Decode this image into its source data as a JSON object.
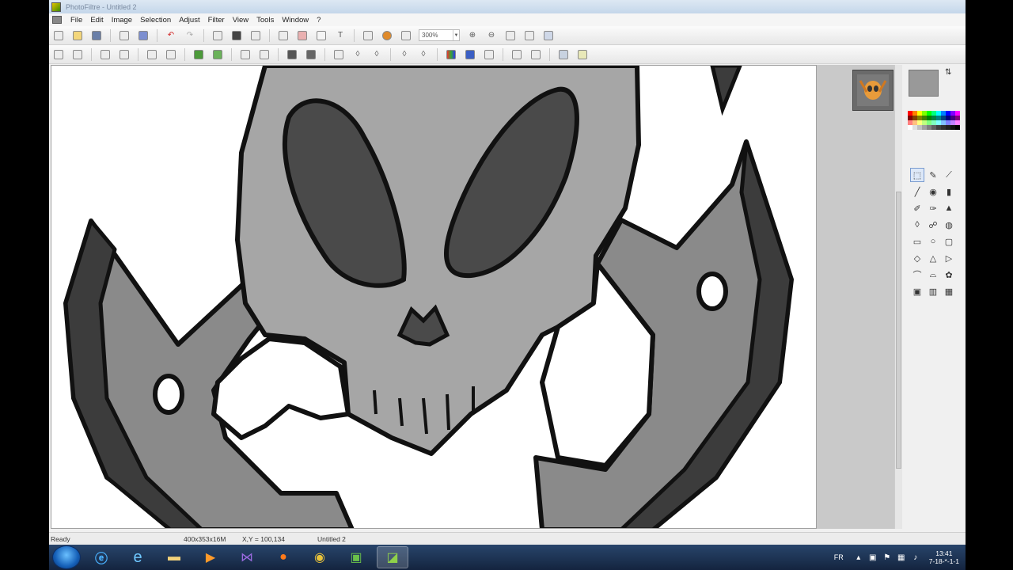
{
  "window": {
    "title": "PhotoFiltre - Untitled 2"
  },
  "menu": [
    "File",
    "Edit",
    "Image",
    "Selection",
    "Adjust",
    "Filter",
    "View",
    "Tools",
    "Window",
    "?"
  ],
  "toolbar": {
    "zoom_value": "300%"
  },
  "status": {
    "ready": "Ready",
    "size": "400x353x16M",
    "coords": "X,Y = 100,134",
    "doc": "Untitled 2"
  },
  "taskbar": {
    "apps": [
      "windows-explorer",
      "ie",
      "file-explorer",
      "media-player",
      "visual-studio",
      "firefox",
      "chrome",
      "app-green",
      "photofiltre"
    ],
    "lang": "FR",
    "time": "13:41",
    "date": "7-18-*-1-1"
  },
  "palette_colors": [
    "#ff0000",
    "#ff8000",
    "#ffff00",
    "#80ff00",
    "#00ff00",
    "#00ff80",
    "#00ffff",
    "#0080ff",
    "#0000ff",
    "#8000ff",
    "#ff00ff",
    "#800000",
    "#804000",
    "#808000",
    "#408000",
    "#008000",
    "#008040",
    "#008080",
    "#004080",
    "#000080",
    "#400080",
    "#800080",
    "#ff8080",
    "#ffc080",
    "#ffff80",
    "#c0ff80",
    "#80ff80",
    "#80ffc0",
    "#80ffff",
    "#80c0ff",
    "#8080ff",
    "#c080ff",
    "#ff80ff",
    "#ffffff",
    "#e0e0e0",
    "#c0c0c0",
    "#a0a0a0",
    "#808080",
    "#606060",
    "#404040",
    "#303030",
    "#202020",
    "#101010",
    "#000000"
  ],
  "colors": {
    "foreground": "#999999",
    "skull_light": "#a6a6a6",
    "skull_dark": "#4a4a4a",
    "blade_mid": "#8a8a8a",
    "blade_dark": "#3c3c3c"
  }
}
